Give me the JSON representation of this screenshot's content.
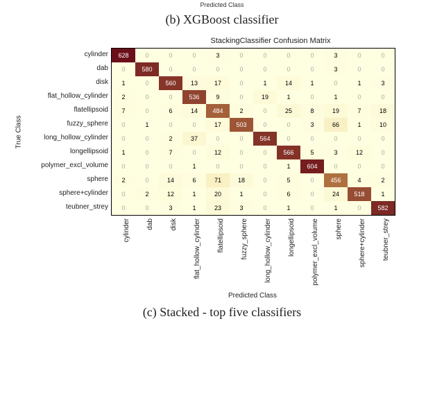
{
  "top_fragment": "Predicted Class",
  "caption_b": "(b) XGBoost classifier",
  "caption_c": "(c) Stacked - top five classifiers",
  "chart_data": {
    "type": "heatmap",
    "title": "StackingClassifier Confusion Matrix",
    "xlabel": "Predicted Class",
    "ylabel": "True Class",
    "row_labels": [
      "cylinder",
      "dab",
      "disk",
      "flat_hollow_cylinder",
      "flatellipsoid",
      "fuzzy_sphere",
      "long_hollow_cylinder",
      "longellipsoid",
      "polymer_excl_volume",
      "sphere",
      "sphere+cylinder",
      "teubner_strey"
    ],
    "col_labels": [
      "cylinder",
      "dab",
      "disk",
      "flat_hollow_cylinder",
      "flatellipsoid",
      "fuzzy_sphere",
      "long_hollow_cylinder",
      "longellipsoid",
      "polymer_excl_volume",
      "sphere",
      "sphere+cylinder",
      "teubner_strey"
    ],
    "matrix": [
      [
        628,
        0,
        0,
        0,
        3,
        0,
        0,
        0,
        0,
        3,
        0,
        0
      ],
      [
        0,
        580,
        0,
        0,
        0,
        0,
        0,
        0,
        0,
        3,
        0,
        0
      ],
      [
        1,
        0,
        560,
        13,
        17,
        0,
        1,
        14,
        1,
        0,
        1,
        3
      ],
      [
        2,
        0,
        0,
        536,
        9,
        0,
        19,
        1,
        0,
        1,
        0,
        0
      ],
      [
        7,
        0,
        6,
        14,
        484,
        2,
        0,
        25,
        8,
        19,
        7,
        18
      ],
      [
        0,
        1,
        0,
        0,
        17,
        503,
        0,
        0,
        3,
        66,
        1,
        10
      ],
      [
        0,
        0,
        2,
        37,
        0,
        0,
        564,
        0,
        0,
        0,
        0,
        0
      ],
      [
        1,
        0,
        7,
        0,
        12,
        0,
        0,
        566,
        5,
        3,
        12,
        0
      ],
      [
        0,
        0,
        0,
        1,
        0,
        0,
        0,
        1,
        604,
        0,
        0,
        0
      ],
      [
        2,
        0,
        14,
        6,
        71,
        18,
        0,
        5,
        0,
        456,
        4,
        2
      ],
      [
        0,
        2,
        12,
        1,
        20,
        1,
        0,
        6,
        0,
        24,
        518,
        1
      ],
      [
        0,
        0,
        3,
        1,
        23,
        3,
        0,
        1,
        0,
        1,
        0,
        582
      ]
    ],
    "vmax": 628,
    "cmap_low": "#fefee0",
    "cmap_mid": "#e8c060",
    "cmap_high": "#6b0f1a",
    "zero_text_color": "#aaaaaa"
  }
}
